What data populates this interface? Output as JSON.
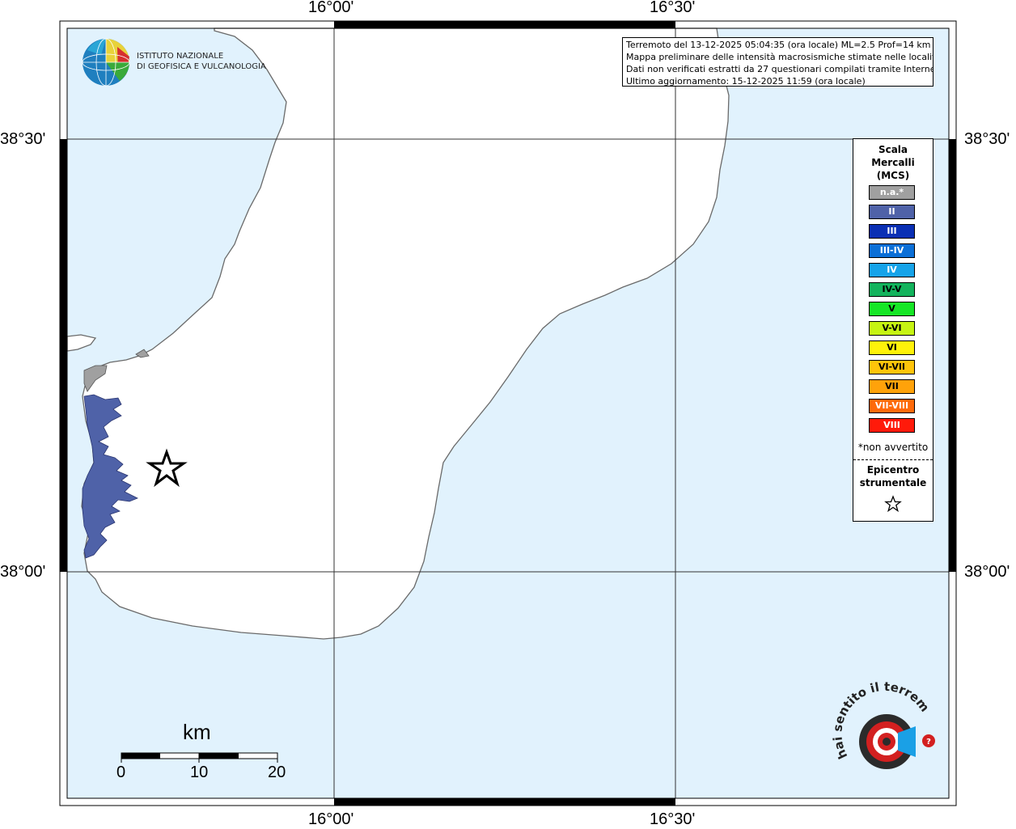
{
  "info": {
    "line1": "Terremoto del 13-12-2025 05:04:35 (ora locale) ML=2.5 Prof=14 km",
    "line2": "Mappa preliminare delle intensità macrosismiche stimate nelle località",
    "line3": "Dati non verificati estratti da 27 questionari compilati tramite Internet.",
    "line4": "Ultimo aggiornamento: 15-12-2025 11:59 (ora locale)"
  },
  "institute": {
    "line1": "ISTITUTO NAZIONALE",
    "line2": "DI GEOFISICA E VULCANOLOGIA"
  },
  "axes": {
    "top": [
      "16°00'",
      "16°30'"
    ],
    "bottom": [
      "16°00'",
      "16°30'"
    ],
    "left": [
      "38°30'",
      "38°00'"
    ],
    "right": [
      "38°30'",
      "38°00'"
    ]
  },
  "legend": {
    "title": [
      "Scala",
      "Mercalli",
      "(MCS)"
    ],
    "items": [
      {
        "label": "n.a.*",
        "color": "#a0a0a0"
      },
      {
        "label": "II",
        "color": "#4f62a8"
      },
      {
        "label": "III",
        "color": "#0a2fb4"
      },
      {
        "label": "III-IV",
        "color": "#0b6fd7"
      },
      {
        "label": "IV",
        "color": "#16a3e9"
      },
      {
        "label": "IV-V",
        "color": "#13b35c"
      },
      {
        "label": "V",
        "color": "#16e626"
      },
      {
        "label": "V-VI",
        "color": "#c6f412"
      },
      {
        "label": "VI",
        "color": "#fff20a"
      },
      {
        "label": "VI-VII",
        "color": "#ffc40a"
      },
      {
        "label": "VII",
        "color": "#ffa20a"
      },
      {
        "label": "VII-VIII",
        "color": "#ff6a0a"
      },
      {
        "label": "VIII",
        "color": "#ff1a0a"
      }
    ],
    "note": "*non avvertito",
    "epicenter": [
      "Epicentro",
      "strumentale"
    ]
  },
  "scale_bar": {
    "title": "km",
    "ticks": [
      "0",
      "10",
      "20"
    ]
  },
  "colors": {
    "sea": "#e1f2fd",
    "land": "#ffffff",
    "intensity_II": "#4f62a8",
    "not_available": "#a0a0a0"
  },
  "icons": {
    "epicenter": "star-icon",
    "ingv_logo": "globe-logo",
    "hsit_logo": "haisentito-logo"
  },
  "badge": "hai sentito il terremoto.it"
}
